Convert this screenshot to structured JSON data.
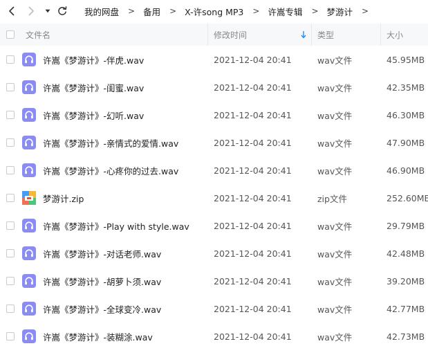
{
  "nav": {
    "breadcrumb": [
      "我的网盘",
      "备用",
      "X-许song MP3",
      "许嵩专辑",
      "梦游计"
    ],
    "separator": ">"
  },
  "header": {
    "name": "文件名",
    "modified": "修改时间",
    "type": "类型",
    "size": "大小"
  },
  "files": [
    {
      "name": "许嵩《梦游计》-伴虎.wav",
      "modified": "2021-12-04 20:41",
      "type": "wav文件",
      "size": "45.95MB",
      "icon": "audio-file-icon"
    },
    {
      "name": "许嵩《梦游计》-闺蜜.wav",
      "modified": "2021-12-04 20:41",
      "type": "wav文件",
      "size": "42.35MB",
      "icon": "audio-file-icon"
    },
    {
      "name": "许嵩《梦游计》-幻听.wav",
      "modified": "2021-12-04 20:41",
      "type": "wav文件",
      "size": "46.30MB",
      "icon": "audio-file-icon"
    },
    {
      "name": "许嵩《梦游计》-亲情式的爱情.wav",
      "modified": "2021-12-04 20:41",
      "type": "wav文件",
      "size": "47.90MB",
      "icon": "audio-file-icon"
    },
    {
      "name": "许嵩《梦游计》-心疼你的过去.wav",
      "modified": "2021-12-04 20:41",
      "type": "wav文件",
      "size": "46.90MB",
      "icon": "audio-file-icon"
    },
    {
      "name": "梦游计.zip",
      "modified": "2021-12-04 20:41",
      "type": "zip文件",
      "size": "252.60MB",
      "icon": "zip-archive-icon"
    },
    {
      "name": "许嵩《梦游计》-Play with style.wav",
      "modified": "2021-12-04 20:41",
      "type": "wav文件",
      "size": "29.79MB",
      "icon": "audio-file-icon"
    },
    {
      "name": "许嵩《梦游计》-对话老师.wav",
      "modified": "2021-12-04 20:41",
      "type": "wav文件",
      "size": "42.48MB",
      "icon": "audio-file-icon"
    },
    {
      "name": "许嵩《梦游计》-胡萝卜须.wav",
      "modified": "2021-12-04 20:41",
      "type": "wav文件",
      "size": "39.20MB",
      "icon": "audio-file-icon"
    },
    {
      "name": "许嵩《梦游计》-全球变冷.wav",
      "modified": "2021-12-04 20:41",
      "type": "wav文件",
      "size": "42.77MB",
      "icon": "audio-file-icon"
    },
    {
      "name": "许嵩《梦游计》-装糊涂.wav",
      "modified": "2021-12-04 20:41",
      "type": "wav文件",
      "size": "42.73MB",
      "icon": "audio-file-icon"
    }
  ],
  "colors": {
    "audio_icon": "#8a8cf2",
    "header_bg": "#f7f8fa",
    "sort_arrow": "#1e90ff"
  }
}
